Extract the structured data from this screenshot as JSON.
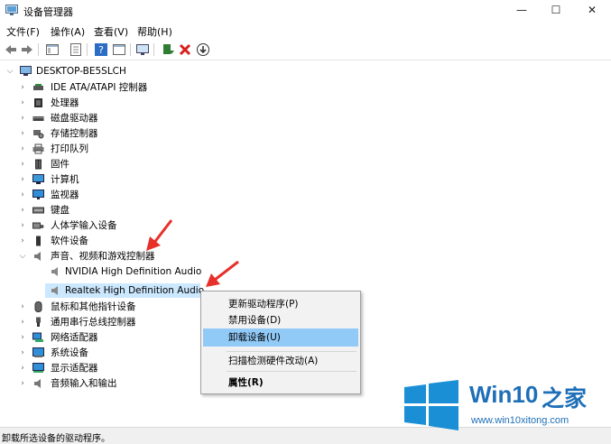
{
  "window": {
    "title": "设备管理器",
    "min": "—",
    "max": "☐",
    "close": "✕"
  },
  "menu": [
    "文件(F)",
    "操作(A)",
    "查看(V)",
    "帮助(H)"
  ],
  "tree": {
    "root": "DESKTOP-BE5SLCH",
    "items": [
      {
        "label": "IDE ATA/ATAPI 控制器",
        "icon": "ide-controller-icon"
      },
      {
        "label": "处理器",
        "icon": "processor-icon"
      },
      {
        "label": "磁盘驱动器",
        "icon": "disk-drive-icon"
      },
      {
        "label": "存储控制器",
        "icon": "storage-controller-icon"
      },
      {
        "label": "打印队列",
        "icon": "printer-icon"
      },
      {
        "label": "固件",
        "icon": "firmware-icon"
      },
      {
        "label": "计算机",
        "icon": "computer-icon"
      },
      {
        "label": "监视器",
        "icon": "monitor-icon"
      },
      {
        "label": "键盘",
        "icon": "keyboard-icon"
      },
      {
        "label": "人体学输入设备",
        "icon": "hid-icon"
      },
      {
        "label": "软件设备",
        "icon": "software-device-icon"
      },
      {
        "label": "声音、视频和游戏控制器",
        "icon": "speaker-icon",
        "expanded": true,
        "children": [
          "NVIDIA High Definition Audio",
          "Realtek High Definition Audio"
        ]
      },
      {
        "label": "鼠标和其他指针设备",
        "icon": "mouse-icon"
      },
      {
        "label": "通用串行总线控制器",
        "icon": "usb-icon"
      },
      {
        "label": "网络适配器",
        "icon": "network-adapter-icon"
      },
      {
        "label": "系统设备",
        "icon": "system-device-icon"
      },
      {
        "label": "显示适配器",
        "icon": "display-adapter-icon"
      },
      {
        "label": "音频输入和输出",
        "icon": "audio-io-icon"
      }
    ]
  },
  "context_menu": {
    "update_driver": "更新驱动程序(P)",
    "disable_device": "禁用设备(D)",
    "uninstall_device": "卸载设备(U)",
    "scan_hardware": "扫描检测硬件改动(A)",
    "properties": "属性(R)"
  },
  "status": "卸载所选设备的驱动程序。",
  "watermark": {
    "brand": "Win10",
    "suffix": "之家",
    "url": "www.win10xitong.com"
  },
  "colors": {
    "selection": "#cce8ff",
    "menu_highlight": "#91c9f7",
    "arrow": "#e8302a",
    "logo_blue": "#1a8fd6"
  }
}
